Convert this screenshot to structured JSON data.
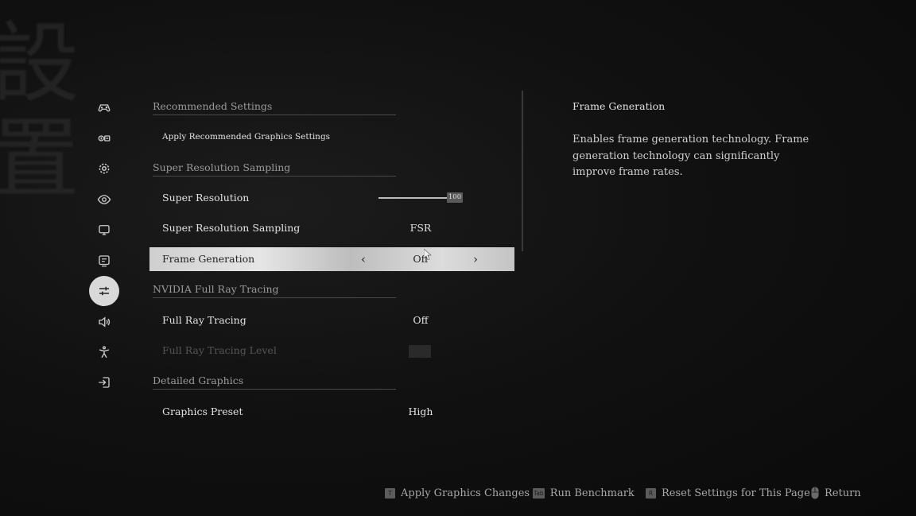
{
  "nav": {
    "items": [
      {
        "id": "controller",
        "icon": "gamepad-icon"
      },
      {
        "id": "key-binding",
        "icon": "keyboard-icon"
      },
      {
        "id": "gameplay",
        "icon": "gear-icon"
      },
      {
        "id": "camera",
        "icon": "eye-icon"
      },
      {
        "id": "display",
        "icon": "monitor-icon"
      },
      {
        "id": "screen",
        "icon": "screen-icon"
      },
      {
        "id": "graphics",
        "icon": "sliders-icon",
        "active": true
      },
      {
        "id": "audio",
        "icon": "speaker-icon"
      },
      {
        "id": "accessibility",
        "icon": "person-icon"
      },
      {
        "id": "exit",
        "icon": "exit-icon"
      }
    ]
  },
  "settings": {
    "recommended_section": "Recommended Settings",
    "apply_recommended": "Apply Recommended Graphics Settings",
    "super_res_section": "Super Resolution Sampling",
    "super_resolution": {
      "label": "Super Resolution",
      "value": "100"
    },
    "super_res_sampling": {
      "label": "Super Resolution Sampling",
      "value": "FSR"
    },
    "frame_generation": {
      "label": "Frame Generation",
      "value": "Off"
    },
    "ray_section": "NVIDIA Full Ray Tracing",
    "full_ray_tracing": {
      "label": "Full Ray Tracing",
      "value": "Off"
    },
    "ray_tracing_level": {
      "label": "Full Ray Tracing Level"
    },
    "detailed_section": "Detailed Graphics",
    "graphics_preset": {
      "label": "Graphics Preset",
      "value": "High"
    }
  },
  "description": {
    "title": "Frame Generation",
    "text": "Enables frame generation technology. Frame generation technology can significantly improve frame rates."
  },
  "footer": {
    "apply": {
      "key": "T",
      "label": "Apply Graphics Changes"
    },
    "benchmark": {
      "key": "Tab",
      "label": "Run Benchmark"
    },
    "reset": {
      "key": "R",
      "label": "Reset Settings for This Page"
    },
    "return": {
      "label": "Return"
    }
  }
}
